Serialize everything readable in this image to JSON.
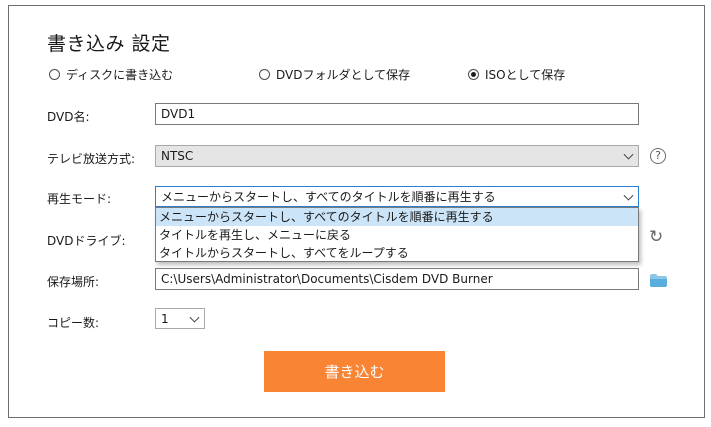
{
  "dialog": {
    "title": "書き込み 設定"
  },
  "mode_options": [
    {
      "label": "ディスクに書き込む",
      "selected": false
    },
    {
      "label": "DVDフォルダとして保存",
      "selected": false
    },
    {
      "label": "ISOとして保存",
      "selected": true
    }
  ],
  "fields": {
    "dvd_name": {
      "label": "DVD名:",
      "value": "DVD1"
    },
    "tv_standard": {
      "label": "テレビ放送方式:",
      "value": "NTSC"
    },
    "playback_mode": {
      "label": "再生モード:",
      "value": "メニューからスタートし、すべてのタイトルを順番に再生する",
      "options": [
        "メニューからスタートし、すべてのタイトルを順番に再生する",
        "タイトルを再生し、メニューに戻る",
        "タイトルからスタートし、すべてをループする"
      ]
    },
    "dvd_drive": {
      "label": "DVDドライブ:"
    },
    "save_location": {
      "label": "保存場所:",
      "value": "C:\\Users\\Administrator\\Documents\\Cisdem DVD Burner"
    },
    "copies": {
      "label": "コピー数:",
      "value": "1"
    }
  },
  "help_icon": "?",
  "actions": {
    "burn_label": "書き込む"
  },
  "colors": {
    "burn_button": "#f88434",
    "dropdown_selection": "#cce4f7",
    "focus_border": "#2a7fd4"
  },
  "icons": {
    "help": "question-circle-icon",
    "refresh": "refresh-icon",
    "folder": "folder-icon"
  }
}
